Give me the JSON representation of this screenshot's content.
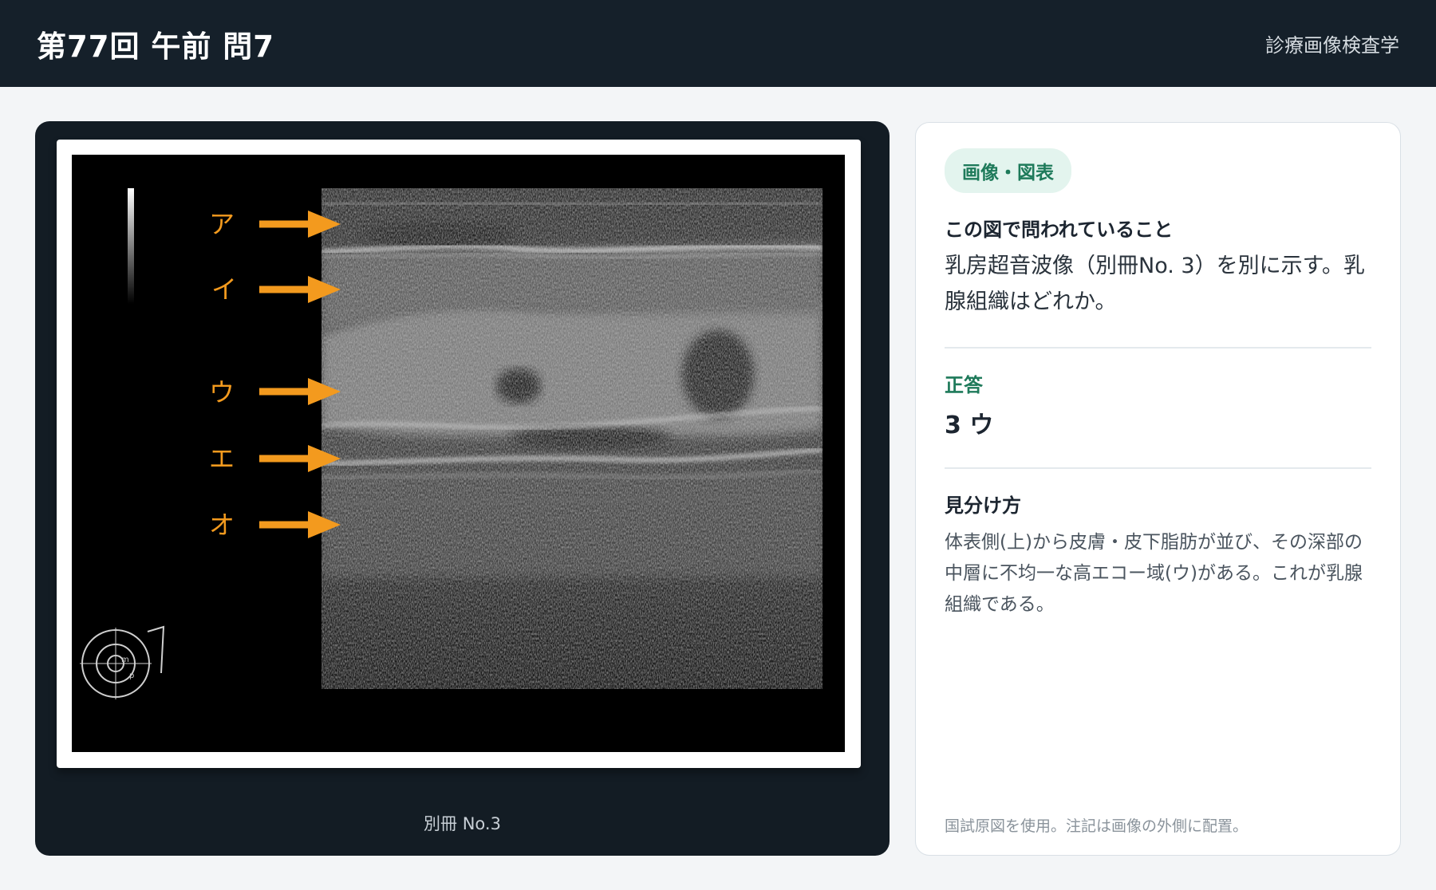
{
  "header": {
    "title": "第77回 午前 問7",
    "subject": "診療画像検査学"
  },
  "figure": {
    "markers": [
      "ア",
      "イ",
      "ウ",
      "エ",
      "オ"
    ],
    "marker_color": "#f39a1e",
    "caption": "別冊 No.3"
  },
  "info": {
    "tag": "画像・図表",
    "question_label": "この図で問われていること",
    "question_text": "乳房超音波像（別冊No. 3）を別に示す。乳腺組織はどれか。",
    "answer_label": "正答",
    "answer_value": "3 ウ",
    "howto_label": "見分け方",
    "howto_text": "体表側(上)から皮膚・皮下脂肪が並び、その深部の中層に不均一な高エコー域(ウ)がある。これが乳腺組織である。",
    "footnote": "国試原図を使用。注記は画像の外側に配置。"
  },
  "colors": {
    "topbar": "#15202a",
    "accent_green": "#1e7a5a"
  }
}
